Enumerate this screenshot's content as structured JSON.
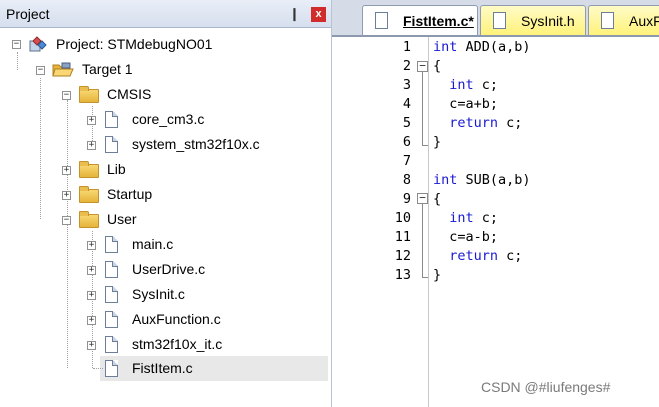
{
  "project_pane": {
    "title": "Project",
    "pin_glyph": "❙",
    "close_glyph": "x",
    "tree": {
      "root": "Project: STMdebugNO01",
      "target": "Target 1",
      "groups": {
        "cmsis": {
          "label": "CMSIS",
          "files": [
            "core_cm3.c",
            "system_stm32f10x.c"
          ]
        },
        "lib": {
          "label": "Lib"
        },
        "startup": {
          "label": "Startup"
        },
        "user": {
          "label": "User",
          "files": [
            "main.c",
            "UserDrive.c",
            "SysInit.c",
            "AuxFunction.c",
            "stm32f10x_it.c",
            "FistItem.c"
          ]
        }
      },
      "selected_file": "FistItem.c"
    }
  },
  "editor": {
    "tabs": [
      {
        "label": "FistItem.c*",
        "active": true
      },
      {
        "label": "SysInit.h",
        "active": false
      },
      {
        "label": "AuxF",
        "active": false
      }
    ],
    "lines": [
      {
        "num": "1",
        "kw": "int",
        "rest": " ADD(a,b)"
      },
      {
        "num": "2",
        "kw": "",
        "rest": "{"
      },
      {
        "num": "3",
        "kw": "  int",
        "rest": " c;"
      },
      {
        "num": "4",
        "kw": "",
        "rest": "  c=a+b;"
      },
      {
        "num": "5",
        "kw": "  return",
        "rest": " c;"
      },
      {
        "num": "6",
        "kw": "",
        "rest": "}"
      },
      {
        "num": "7",
        "kw": "",
        "rest": ""
      },
      {
        "num": "8",
        "kw": "int",
        "rest": " SUB(a,b)"
      },
      {
        "num": "9",
        "kw": "",
        "rest": "{"
      },
      {
        "num": "10",
        "kw": "  int",
        "rest": " c;"
      },
      {
        "num": "11",
        "kw": "",
        "rest": "  c=a-b;"
      },
      {
        "num": "12",
        "kw": "  return",
        "rest": " c;"
      },
      {
        "num": "13",
        "kw": "",
        "rest": "}"
      }
    ],
    "fold_minus": "−"
  },
  "watermark": "CSDN @#liufenges#",
  "colors": {
    "keyword": "#1a1ad0",
    "active_tab": "#ffffff",
    "inactive_tab": "#fff27a",
    "selection": "#e8e8e8"
  },
  "icons": {
    "project": "project-icon",
    "target": "target-folder-icon",
    "folder": "folder-icon",
    "file": "file-icon"
  }
}
